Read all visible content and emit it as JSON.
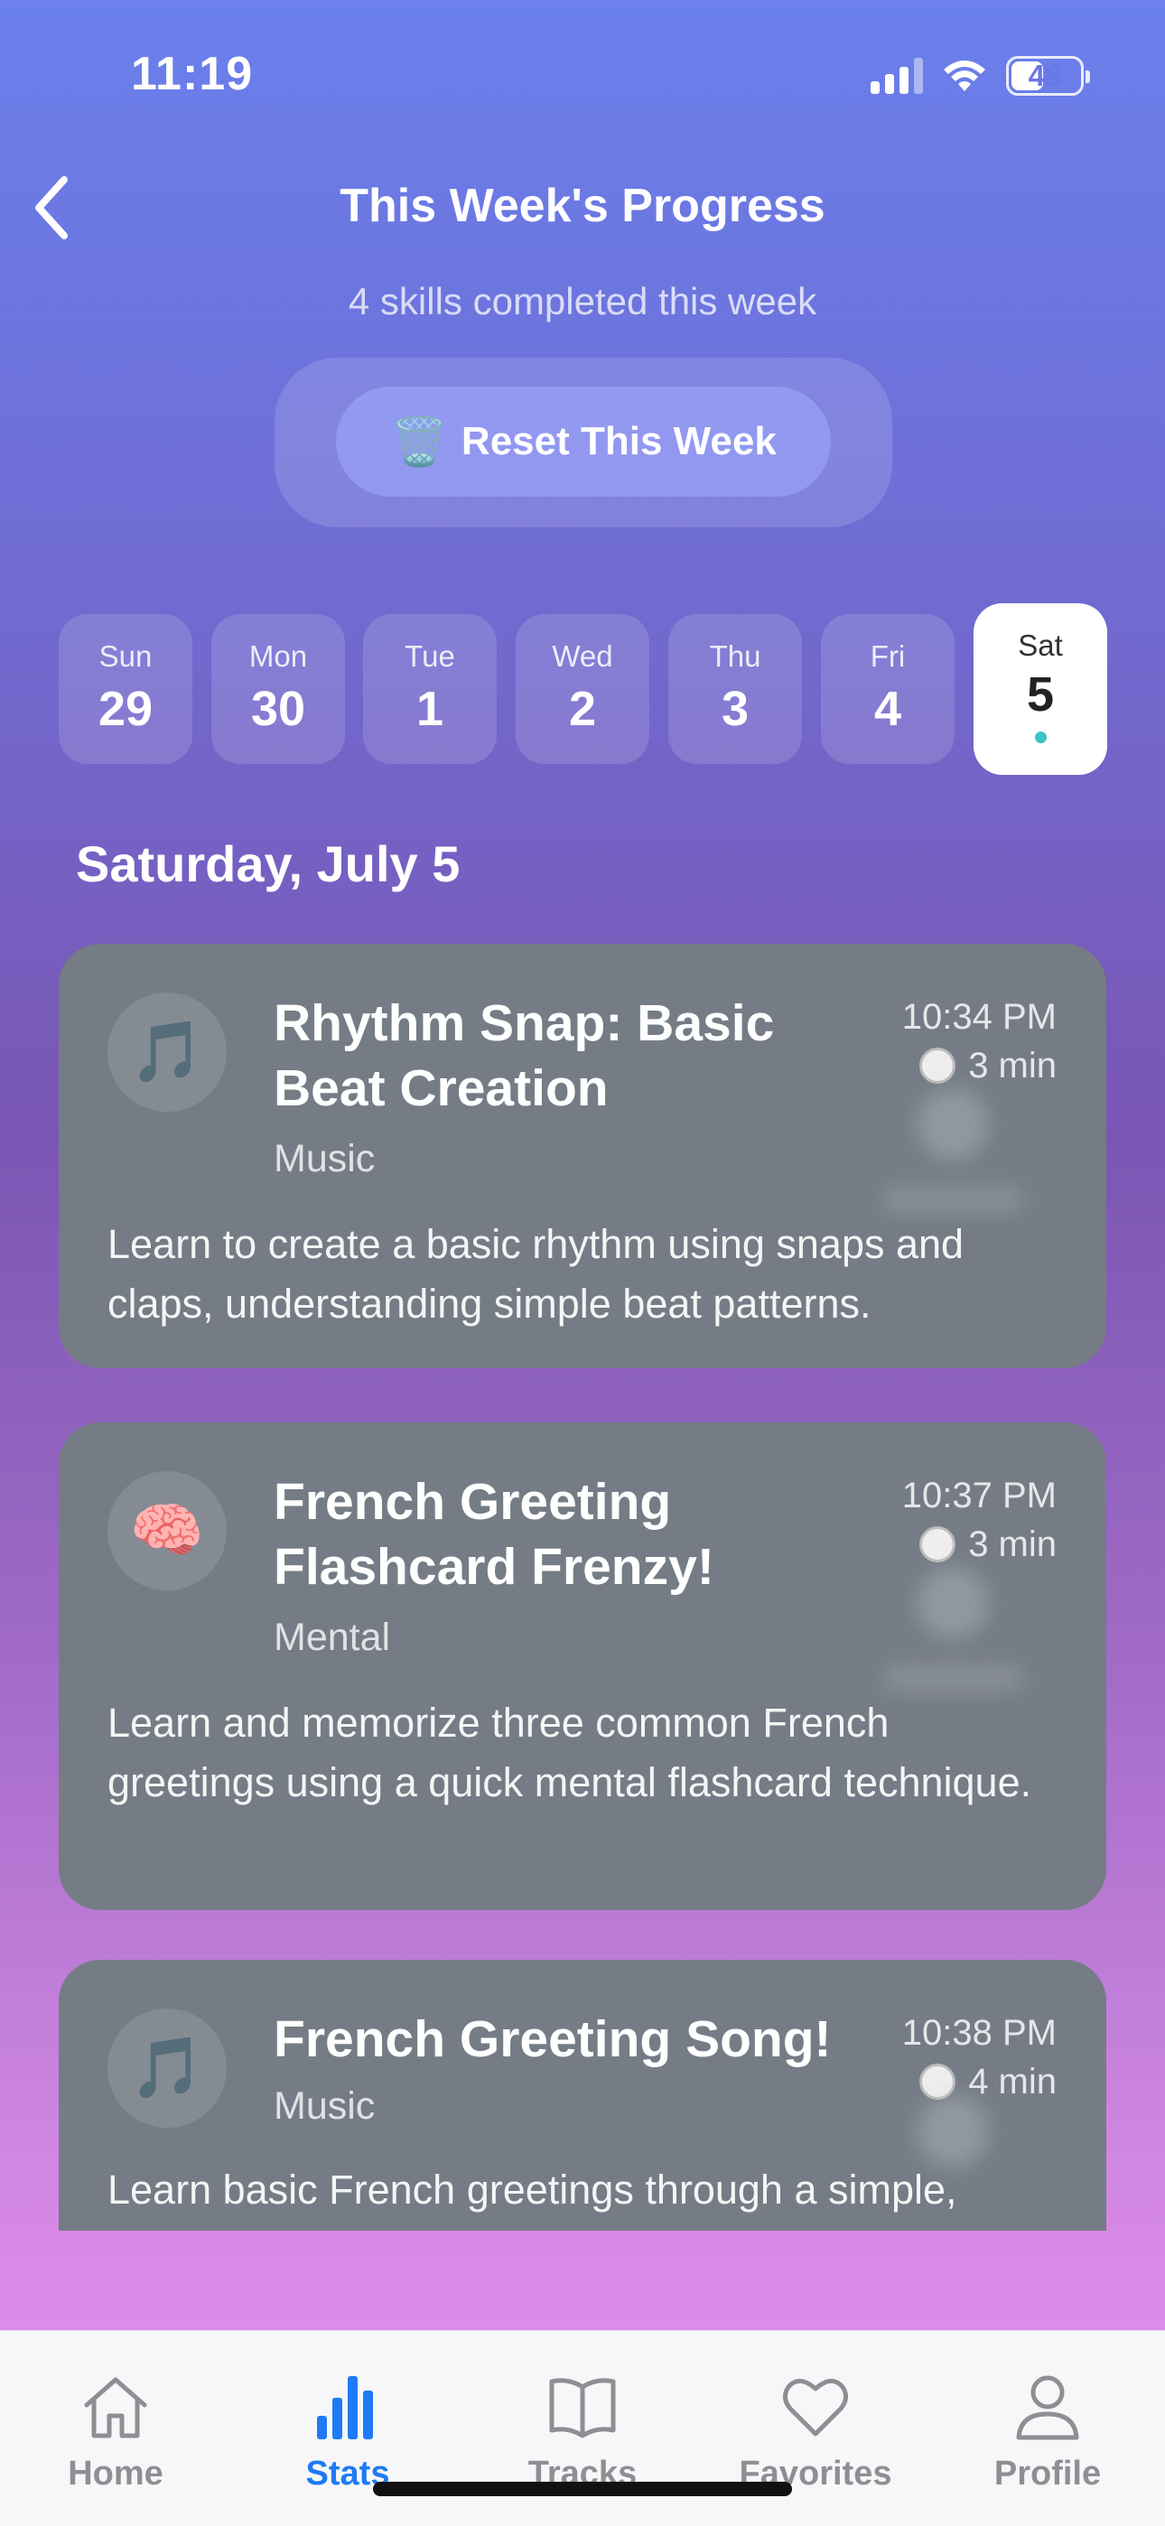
{
  "status_bar": {
    "time": "11:19",
    "battery": "48"
  },
  "header": {
    "title": "This Week's Progress",
    "subtitle": "4 skills completed this week",
    "reset_label": "Reset This Week",
    "reset_emoji": "🗑️"
  },
  "days": [
    {
      "name": "Sun",
      "num": "29"
    },
    {
      "name": "Mon",
      "num": "30"
    },
    {
      "name": "Tue",
      "num": "1"
    },
    {
      "name": "Wed",
      "num": "2"
    },
    {
      "name": "Thu",
      "num": "3"
    },
    {
      "name": "Fri",
      "num": "4"
    },
    {
      "name": "Sat",
      "num": "5"
    }
  ],
  "selected_date": "Saturday, July 5",
  "cards": [
    {
      "emoji": "🎵",
      "title": "Rhythm Snap: Basic Beat Creation",
      "category": "Music",
      "time": "10:34 PM",
      "duration": "3 min",
      "description": "Learn to create a basic rhythm using snaps and claps, understanding simple beat patterns."
    },
    {
      "emoji": "🧠",
      "title": "French Greeting Flashcard Frenzy!",
      "category": "Mental",
      "time": "10:37 PM",
      "duration": "3 min",
      "description": "Learn and memorize three common French greetings using a quick mental flashcard technique."
    },
    {
      "emoji": "🎵",
      "title": "French Greeting Song!",
      "category": "Music",
      "time": "10:38 PM",
      "duration": "4 min",
      "description": "Learn basic French greetings through a simple,"
    }
  ],
  "tabs": [
    {
      "label": "Home",
      "icon": "house-icon"
    },
    {
      "label": "Stats",
      "icon": "bar-chart-icon"
    },
    {
      "label": "Tracks",
      "icon": "book-icon"
    },
    {
      "label": "Favorites",
      "icon": "heart-icon"
    },
    {
      "label": "Profile",
      "icon": "person-icon"
    }
  ],
  "colors": {
    "accent": "#1e7bf5",
    "card_bg": "#757c85",
    "dot": "#3cc3c3"
  }
}
